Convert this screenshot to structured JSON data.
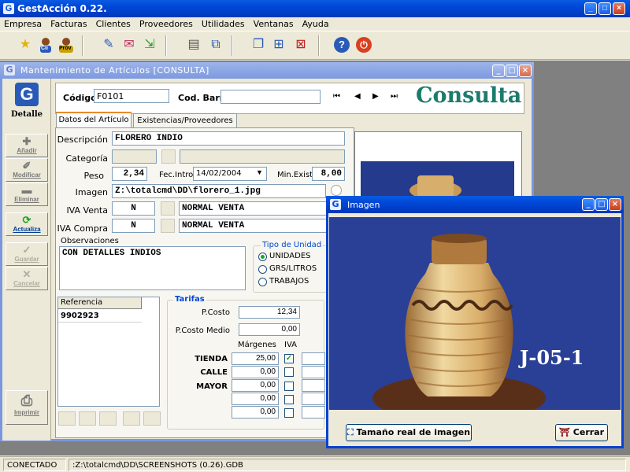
{
  "app": {
    "title": "GestAcción 0.22."
  },
  "menu": [
    "Empresa",
    "Facturas",
    "Clientes",
    "Proveedores",
    "Utilidades",
    "Ventanas",
    "Ayuda"
  ],
  "toolbar": {
    "icons": [
      "star-icon",
      "client-icon",
      "supplier-icon",
      "document-edit-icon",
      "mail-icon",
      "import-icon",
      "book-icon",
      "link-icon",
      "window-icon",
      "tile-icon",
      "close-window-icon",
      "help-icon",
      "power-icon"
    ],
    "badge_cli": "Cli",
    "badge_prov": "Prov"
  },
  "child": {
    "title": "Mantenimiento de Artículos   [CONSULTA]",
    "mode_label": "Detalle",
    "mode_big": "Consulta",
    "codigo_label": "Código",
    "codigo_value": "F0101",
    "codbarr_label": "Cod. Barr.",
    "codbarr_value": ""
  },
  "sidebar": {
    "anadir": "Añadir",
    "modificar": "Modificar",
    "eliminar": "Eliminar",
    "actualiza": "Actualiza",
    "guardar": "Guardar",
    "cancelar": "Cancelar",
    "imprimir": "Imprimir"
  },
  "tabs": [
    "Datos del Artículo",
    "Existencias/Proveedores"
  ],
  "form": {
    "descripcion_label": "Descripción",
    "descripcion_value": "FLORERO INDIO",
    "categoria_label": "Categoría",
    "peso_label": "Peso",
    "peso_value": "2,34",
    "fecintro_label": "Fec.Intro.",
    "fecintro_value": "14/02/2004",
    "minexist_label": "Min.Exist",
    "minexist_value": "8,00",
    "imagen_label": "Imagen",
    "imagen_value": "Z:\\totalcmd\\DD\\florero_1.jpg",
    "ivaventa_label": "IVA Venta",
    "ivaventa_code": "N",
    "ivaventa_desc": "NORMAL VENTA",
    "ivacompra_label": "IVA Compra",
    "ivacompra_code": "N",
    "ivacompra_desc": "NORMAL VENTA",
    "observaciones_label": "Observaciones",
    "observaciones_value": "CON DETALLES INDIOS",
    "tipo_unidad_label": "Tipo de Unidad",
    "tipo_unidad_options": [
      "UNIDADES",
      "GRS/LITROS",
      "TRABAJOS"
    ],
    "tipo_unidad_selected": "UNIDADES"
  },
  "referencia": {
    "header": "Referencia",
    "rows": [
      "9902923"
    ]
  },
  "tarifas": {
    "title": "Tarifas",
    "pcosto_label": "P.Costo",
    "pcosto_value": "12,34",
    "pcostomedio_label": "P.Costo Medio",
    "pcostomedio_value": "0,00",
    "margenes_header": "Márgenes",
    "iva_header": "IVA",
    "rows": [
      {
        "name": "TIENDA",
        "margin": "25,00",
        "iva": true
      },
      {
        "name": "CALLE",
        "margin": "0,00",
        "iva": false
      },
      {
        "name": "MAYOR",
        "margin": "0,00",
        "iva": false
      },
      {
        "name": "",
        "margin": "0,00",
        "iva": false
      },
      {
        "name": "",
        "margin": "0,00",
        "iva": false
      }
    ]
  },
  "dialog": {
    "title": "Imagen",
    "photo_caption": "J-05-1",
    "btn_real_size": "Tamaño real de imagen",
    "btn_close": "Cerrar"
  },
  "statusbar": {
    "state": "CONECTADO",
    "path": ":Z:\\totalcmd\\DD\\SCREENSHOTS (0.26).GDB"
  },
  "colors": {
    "title_blue": "#0047d8",
    "consulta_green": "#1d7b6c",
    "photo_bg": "#243a8c"
  }
}
